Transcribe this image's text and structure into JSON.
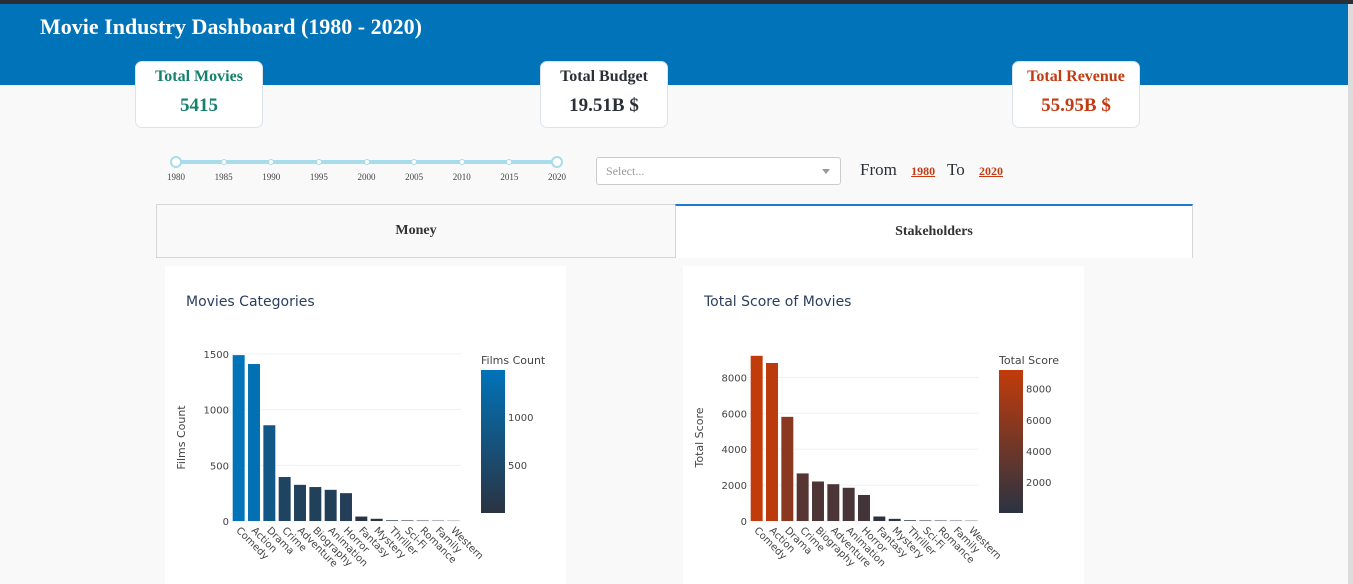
{
  "header": {
    "title": "Movie Industry Dashboard (1980 - 2020)"
  },
  "cards": {
    "movies": {
      "title": "Total Movies",
      "value": "5415"
    },
    "budget": {
      "title": "Total Budget",
      "value": "19.51B $"
    },
    "revenue": {
      "title": "Total Revenue",
      "value": "55.95B $"
    }
  },
  "filters": {
    "slider": {
      "labels": [
        "1980",
        "1985",
        "1990",
        "1995",
        "2000",
        "2005",
        "2010",
        "2015",
        "2020"
      ],
      "min": 1980,
      "max": 2020,
      "value": [
        1980,
        2020
      ]
    },
    "select_placeholder": "Select...",
    "from_label": "From",
    "to_label": "To",
    "from_year": "1980",
    "to_year": "2020"
  },
  "tabs": {
    "money": "Money",
    "stakeholders": "Stakeholders",
    "active": "Stakeholders"
  },
  "colors": {
    "header": "#0073b9",
    "teal": "#16806e",
    "red": "#c23b12",
    "blue_bar": "#0073b9",
    "slider": "#a9dcea"
  },
  "chart_data": [
    {
      "type": "bar",
      "title": "Movies Categories",
      "ylabel": "Films Count",
      "xlabel": "",
      "colorbar_title": "Films Count",
      "colorbar_ticks": [
        500,
        1000
      ],
      "ylim": [
        0,
        1500
      ],
      "yticks": [
        0,
        500,
        1000,
        1500
      ],
      "colorscale": [
        "#2a3342",
        "#0073b9"
      ],
      "categories": [
        "Comedy",
        "Action",
        "Drama",
        "Crime",
        "Adventure",
        "Biography",
        "Animation",
        "Horror",
        "Fantasy",
        "Mystery",
        "Thriller",
        "Sci-Fi",
        "Romance",
        "Family",
        "Western"
      ],
      "values": [
        1490,
        1410,
        860,
        395,
        325,
        305,
        280,
        250,
        40,
        20,
        6,
        5,
        4,
        3,
        2
      ]
    },
    {
      "type": "bar",
      "title": "Total Score of Movies",
      "ylabel": "Total Score",
      "xlabel": "",
      "colorbar_title": "Total Score",
      "colorbar_ticks": [
        2000,
        4000,
        6000,
        8000
      ],
      "ylim": [
        0,
        9300
      ],
      "yticks": [
        0,
        2000,
        4000,
        6000,
        8000
      ],
      "colorscale": [
        "#2a3342",
        "#c23b0a"
      ],
      "categories": [
        "Comedy",
        "Action",
        "Drama",
        "Crime",
        "Biography",
        "Adventure",
        "Animation",
        "Horror",
        "Fantasy",
        "Mystery",
        "Thriller",
        "Sci-Fi",
        "Romance",
        "Family",
        "Western"
      ],
      "values": [
        9200,
        8800,
        5800,
        2650,
        2200,
        2050,
        1850,
        1450,
        250,
        120,
        40,
        30,
        25,
        20,
        15
      ]
    }
  ]
}
